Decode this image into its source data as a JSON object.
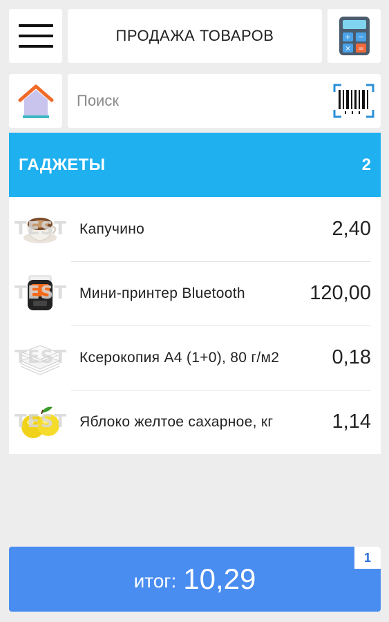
{
  "header": {
    "title": "ПРОДАЖА ТОВАРОВ",
    "menu_icon": "hamburger-menu-icon",
    "calculator_icon": "calculator-icon"
  },
  "search": {
    "placeholder": "Поиск",
    "value": "",
    "home_icon": "home-icon",
    "barcode_icon": "barcode-scanner-icon"
  },
  "category": {
    "name": "ГАДЖЕТЫ",
    "count": "2",
    "color": "#1fb0f0"
  },
  "products": [
    {
      "name": "Капучино",
      "price": "2,40",
      "icon": "cappuccino-image",
      "watermark": "TEST"
    },
    {
      "name": "Мини-принтер Bluetooth",
      "price": "120,00",
      "icon": "mini-printer-image",
      "watermark": "TEST"
    },
    {
      "name": "Ксерокопия А4 (1+0), 80 г/м2",
      "price": "0,18",
      "icon": "paper-stack-image",
      "watermark": "TEST"
    },
    {
      "name": "Яблоко желтое сахарное, кг",
      "price": "1,14",
      "icon": "yellow-apple-image",
      "watermark": "TEST"
    }
  ],
  "total": {
    "label": "итог:",
    "value": "10,29",
    "badge": "1",
    "color": "#4a8df0"
  }
}
